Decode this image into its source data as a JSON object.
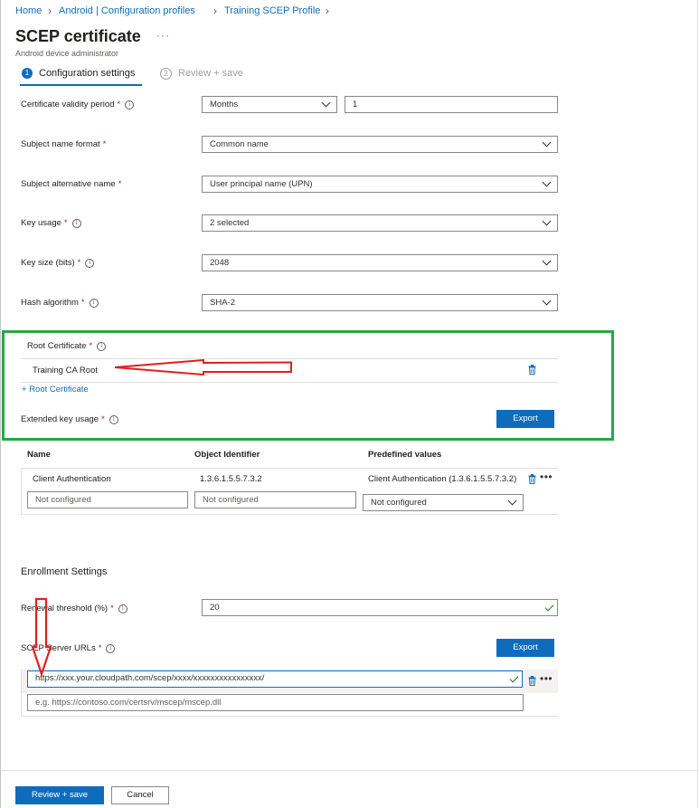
{
  "breadcrumb": [
    "Home",
    "Android | Configuration profiles",
    "Training SCEP Profile"
  ],
  "page": {
    "title": "SCEP certificate",
    "subtitle": "Android device administrator",
    "more": "···"
  },
  "steps": [
    {
      "number": "1",
      "label": "Configuration settings",
      "active": true
    },
    {
      "number": "2",
      "label": "Review + save",
      "active": false
    }
  ],
  "fields": {
    "validity_period": {
      "label": "Certificate validity period",
      "unit": "Months",
      "value": "1"
    },
    "subject_name_format": {
      "label": "Subject name format",
      "value": "Common name"
    },
    "subject_alt_name": {
      "label": "Subject alternative name",
      "value": "User principal name (UPN)"
    },
    "key_usage": {
      "label": "Key usage",
      "value": "2 selected"
    },
    "key_size": {
      "label": "Key size (bits)",
      "value": "2048"
    },
    "hash_algorithm": {
      "label": "Hash algorithm",
      "value": "SHA-2"
    }
  },
  "root_certificate": {
    "label": "Root Certificate",
    "item": "Training CA Root",
    "add_link": "+ Root Certificate"
  },
  "eku": {
    "label": "Extended key usage",
    "export_label": "Export",
    "columns": [
      "Name",
      "Object Identifier",
      "Predefined values"
    ],
    "row": {
      "name": "Client Authentication",
      "oid": "1.3.6.1.5.5.7.3.2",
      "predefined": "Client Authentication (1.3.6.1.5.5.7.3.2)"
    },
    "new_row": {
      "name_placeholder": "Not configured",
      "oid_placeholder": "Not configured",
      "predefined": "Not configured"
    }
  },
  "enrollment": {
    "heading": "Enrollment Settings",
    "renewal_label": "Renewal threshold (%)",
    "renewal_value": "20",
    "urls_label": "SCEP Server URLs",
    "export_label": "Export",
    "url_value": "https://xxx.your.cloudpath.com/scep/xxxx/xxxxxxxxxxxxxxxx/",
    "url_placeholder": "e.g. https://contoso.com/certsrv/mscep/mscep.dll"
  },
  "footer": {
    "primary": "Review + save",
    "secondary": "Cancel"
  },
  "colors": {
    "accent": "#0f6cbd",
    "highlight_box": "#28a745",
    "annotation_arrow": "#e02020",
    "required": "#a4262c"
  },
  "icons": [
    "chevron-right-icon",
    "chevron-down-icon",
    "info-icon",
    "trash-icon",
    "more-icon",
    "checkmark-icon",
    "plus-icon"
  ]
}
